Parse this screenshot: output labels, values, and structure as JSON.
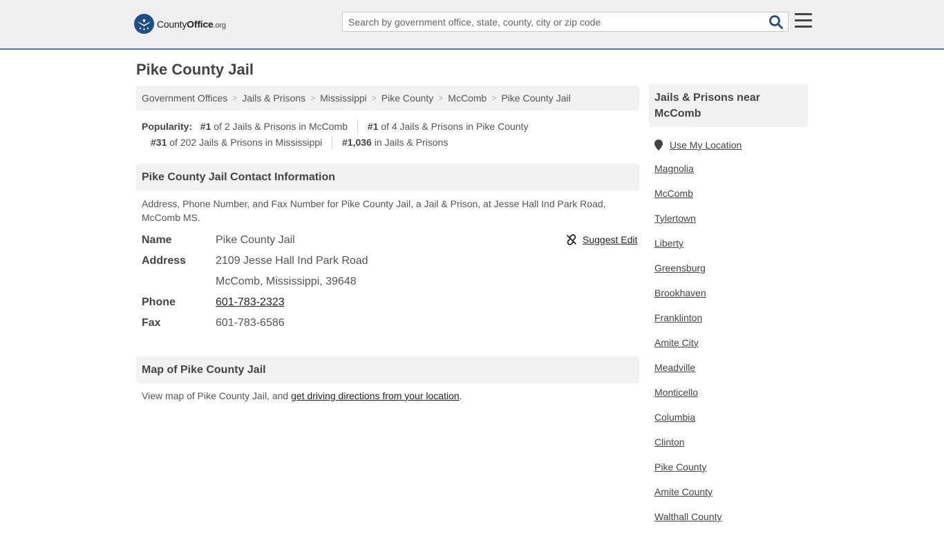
{
  "header": {
    "logo_county": "County",
    "logo_office": "Office",
    "logo_org": ".org",
    "search_placeholder": "Search by government office, state, county, city or zip code",
    "brand_color": "#1f4e86",
    "accent_color": "#4a7ab0"
  },
  "page": {
    "title": "Pike County Jail"
  },
  "breadcrumb": [
    "Government Offices",
    "Jails & Prisons",
    "Mississippi",
    "Pike County",
    "McComb",
    "Pike County Jail"
  ],
  "popularity": {
    "label": "Popularity:",
    "r1_rank": "#1",
    "r1_text": "of 2 Jails & Prisons in McComb",
    "r2_rank": "#1",
    "r2_text": "of 4 Jails & Prisons in Pike County",
    "r3_rank": "#31",
    "r3_text": "of 202 Jails & Prisons in Mississippi",
    "r4_rank": "#1,036",
    "r4_text": "in Jails & Prisons"
  },
  "contact": {
    "heading": "Pike County Jail Contact Information",
    "description": "Address, Phone Number, and Fax Number for Pike County Jail, a Jail & Prison, at Jesse Hall Ind Park Road, McComb MS.",
    "suggest_edit": "Suggest Edit",
    "name_label": "Name",
    "name_value": "Pike County Jail",
    "address_label": "Address",
    "address_line1": "2109 Jesse Hall Ind Park Road",
    "address_line2": "McComb, Mississippi, 39648",
    "phone_label": "Phone",
    "phone_value": "601-783-2323",
    "fax_label": "Fax",
    "fax_value": "601-783-6586"
  },
  "map": {
    "heading": "Map of Pike County Jail",
    "text_before": "View map of Pike County Jail, and ",
    "link": "get driving directions from your location",
    "text_after": "."
  },
  "sidebar": {
    "heading": "Jails & Prisons near McComb",
    "use_location": "Use My Location",
    "items": [
      "Magnolia",
      "McComb",
      "Tylertown",
      "Liberty",
      "Greensburg",
      "Brookhaven",
      "Franklinton",
      "Amite City",
      "Meadville",
      "Monticello",
      "Columbia",
      "Clinton",
      "Pike County",
      "Amite County",
      "Walthall County"
    ]
  }
}
